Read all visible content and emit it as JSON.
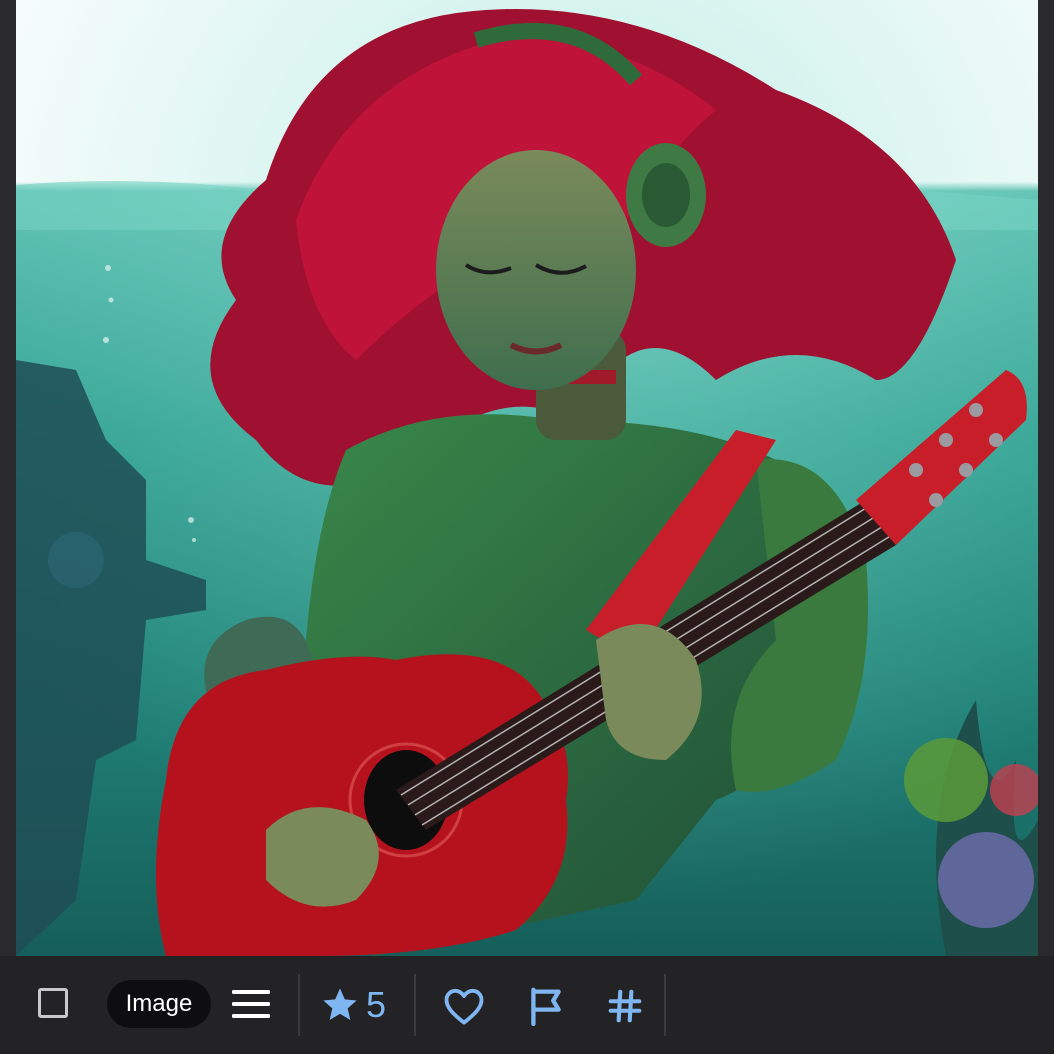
{
  "toolbar": {
    "type_label": "Image",
    "rating_value": "5"
  },
  "icons": {
    "select": "checkbox-icon",
    "menu": "hamburger-menu-icon",
    "rating": "star-icon",
    "like": "heart-icon",
    "report": "flag-icon",
    "tags": "hashtag-icon"
  },
  "colors": {
    "accent": "#7fb6f2",
    "toolbar_bg": "#232325",
    "pill_bg": "#0e0e10"
  }
}
